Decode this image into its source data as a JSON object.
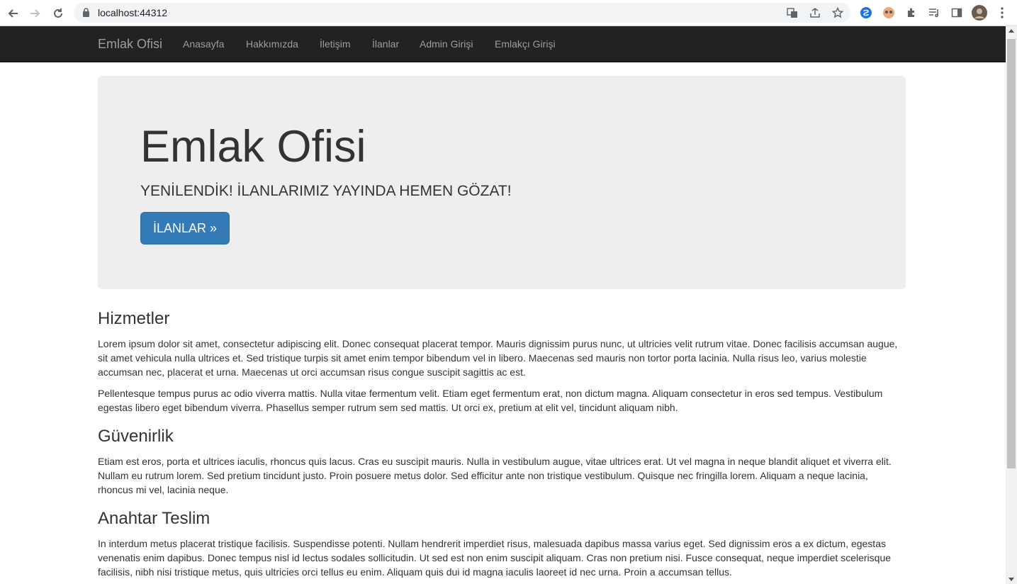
{
  "browser": {
    "url": "localhost:44312"
  },
  "site": {
    "brand": "Emlak Ofisi",
    "nav": [
      "Anasayfa",
      "Hakkımızda",
      "İletişim",
      "İlanlar",
      "Admin Girişi",
      "Emlakçı Girişi"
    ]
  },
  "jumbotron": {
    "title": "Emlak Ofisi",
    "subtitle": "YENİLENDİK! İLANLARIMIZ YAYINDA HEMEN GÖZAT!",
    "button_label": "İLANLAR »"
  },
  "sections": [
    {
      "title": "Hizmetler",
      "paragraphs": [
        "Lorem ipsum dolor sit amet, consectetur adipiscing elit. Donec consequat placerat tempor. Mauris dignissim purus nunc, ut ultricies velit rutrum vitae. Donec facilisis accumsan augue, sit amet vehicula nulla ultrices et. Sed tristique turpis sit amet enim tempor bibendum vel in libero. Maecenas sed mauris non tortor porta lacinia. Nulla risus leo, varius molestie accumsan nec, placerat et urna. Maecenas ut orci accumsan risus congue suscipit sagittis ac est.",
        "Pellentesque tempus purus ac odio viverra mattis. Nulla vitae fermentum velit. Etiam eget fermentum erat, non dictum magna. Aliquam consectetur in eros sed tempus. Vestibulum egestas libero eget bibendum viverra. Phasellus semper rutrum sem sed mattis. Ut orci ex, pretium at elit vel, tincidunt aliquam nibh."
      ]
    },
    {
      "title": "Güvenirlik",
      "paragraphs": [
        "Etiam est eros, porta et ultrices iaculis, rhoncus quis lacus. Cras eu suscipit mauris. Nulla in vestibulum augue, vitae ultrices erat. Ut vel magna in neque blandit aliquet et viverra elit. Nullam eu rutrum lorem. Sed pretium tincidunt justo. Proin posuere metus dolor. Sed efficitur ante non tristique vestibulum. Quisque nec fringilla lorem. Aliquam a neque lacinia, rhoncus mi vel, lacinia neque."
      ]
    },
    {
      "title": "Anahtar Teslim",
      "paragraphs": [
        "In interdum metus placerat tristique facilisis. Suspendisse potenti. Nullam hendrerit imperdiet risus, malesuada dapibus massa varius eget. Sed dignissim eros a ex dictum, egestas venenatis enim dapibus. Donec tempus nisl id lectus sodales sollicitudin. Ut sed est non enim suscipit aliquam. Cras non pretium nisi. Fusce consequat, neque imperdiet scelerisque facilisis, nibh nisi tristique metus, quis ultricies orci tellus eu enim. Aliquam quis dui id magna iaculis laoreet id nec urna. Proin a accumsan tellus."
      ]
    }
  ],
  "colors": {
    "navbar_bg": "#222222",
    "nav_text": "#9d9d9d",
    "jumbotron_bg": "#eeeeee",
    "primary_button": "#337ab7"
  },
  "icons": [
    "back-arrow-icon",
    "forward-arrow-icon",
    "reload-icon",
    "lock-icon",
    "translate-icon",
    "share-icon",
    "bookmark-star-icon",
    "extension-icon",
    "reading-list-icon",
    "side-panel-icon",
    "profile-avatar-icon",
    "more-menu-icon"
  ]
}
